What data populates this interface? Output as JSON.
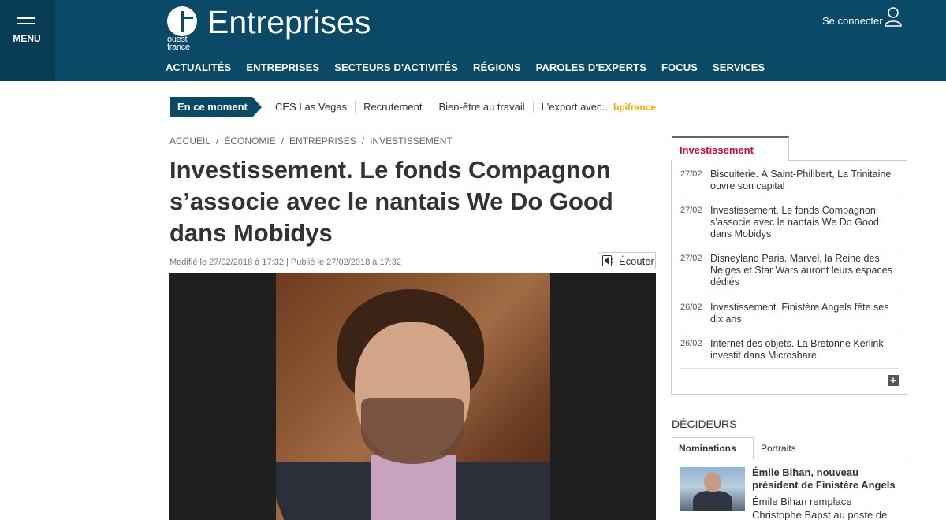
{
  "header": {
    "menu_label": "MENU",
    "logo_text": "ouest france",
    "site_title": "Entreprises",
    "connect_label": "Se connecter",
    "nav": [
      "ACTUALITÉS",
      "ENTREPRISES",
      "SECTEURS D'ACTIVITÉS",
      "RÉGIONS",
      "PAROLES D'EXPERTS",
      "FOCUS",
      "SERVICES"
    ]
  },
  "moment": {
    "badge": "En ce moment",
    "links": [
      "CES Las Vegas",
      "Recrutement",
      "Bien-être au travail"
    ],
    "export_label": "L'export avec...",
    "bpi_logo": "bpifrance"
  },
  "breadcrumb": [
    "ACCUEIL",
    "ÉCONOMIE",
    "ENTREPRISES",
    "INVESTISSEMENT"
  ],
  "article": {
    "title": "Investissement. Le fonds Compagnon s’associe avec le nantais We Do Good dans Mobidys",
    "meta": "Modifié le 27/02/2018 à 17:32 | Publié le 27/02/2018 à 17:32",
    "listen_label": "Écouter"
  },
  "sidebar": {
    "tab_label": "Investissement",
    "items": [
      {
        "date": "27/02",
        "text": "Biscuiterie. À Saint-Philibert, La Trinitaine ouvre son capital"
      },
      {
        "date": "27/02",
        "text": "Investissement. Le fonds Compagnon s’associe avec le nantais We Do Good dans Mobidys"
      },
      {
        "date": "27/02",
        "text": "Disneyland Paris. Marvel, la Reine des Neiges et Star Wars auront leurs espaces dédiés"
      },
      {
        "date": "26/02",
        "text": "Investissement. Finistère Angels fête ses dix ans"
      },
      {
        "date": "26/02",
        "text": "Internet des objets. La Bretonne Kerlink investit dans Microshare"
      }
    ],
    "more_label": "+"
  },
  "decideurs": {
    "heading": "DÉCIDEURS",
    "tabs": [
      "Nominations",
      "Portraits"
    ],
    "headline": "Émile Bihan, nouveau président de Finistère Angels",
    "excerpt": "Émile Bihan remplace Christophe Bapst au poste de"
  },
  "colors": {
    "header_bg": "#0b4a66",
    "accent_red": "#c8102e"
  }
}
